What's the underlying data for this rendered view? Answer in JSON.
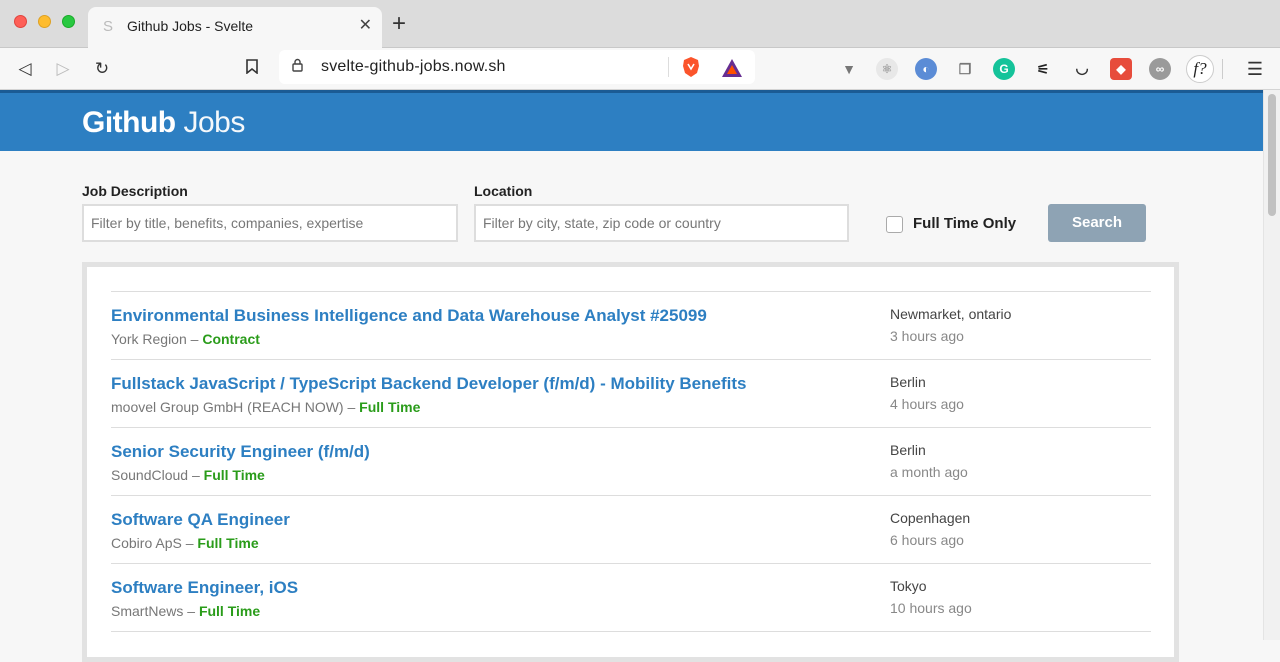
{
  "browser": {
    "tab_title": "Github Jobs - Svelte",
    "url": "svelte-github-jobs.now.sh",
    "colors": {
      "accent": "#2d7fc2"
    }
  },
  "header": {
    "logo_bold": "Github",
    "logo_light": "Jobs"
  },
  "filters": {
    "description_label": "Job Description",
    "description_placeholder": "Filter by title, benefits, companies, expertise",
    "location_label": "Location",
    "location_placeholder": "Filter by city, state, zip code or country",
    "fulltime_label": "Full Time Only",
    "search_label": "Search"
  },
  "jobs": [
    {
      "title": "Environmental Business Intelligence and Data Warehouse Analyst #25099",
      "company": "York Region",
      "type": "Contract",
      "location": "Newmarket, ontario",
      "posted": "3 hours ago"
    },
    {
      "title": "Fullstack JavaScript / TypeScript Backend Developer (f/m/d) - Mobility Benefits",
      "company": "moovel Group GmbH (REACH NOW)",
      "type": "Full Time",
      "location": "Berlin",
      "posted": "4 hours ago"
    },
    {
      "title": "Senior Security Engineer (f/m/d)",
      "company": "SoundCloud",
      "type": "Full Time",
      "location": "Berlin",
      "posted": "a month ago"
    },
    {
      "title": "Software QA Engineer",
      "company": "Cobiro ApS",
      "type": "Full Time",
      "location": "Copenhagen",
      "posted": "6 hours ago"
    },
    {
      "title": "Software Engineer, iOS",
      "company": "SmartNews",
      "type": "Full Time",
      "location": "Tokyo",
      "posted": "10 hours ago"
    }
  ],
  "separator": " – "
}
